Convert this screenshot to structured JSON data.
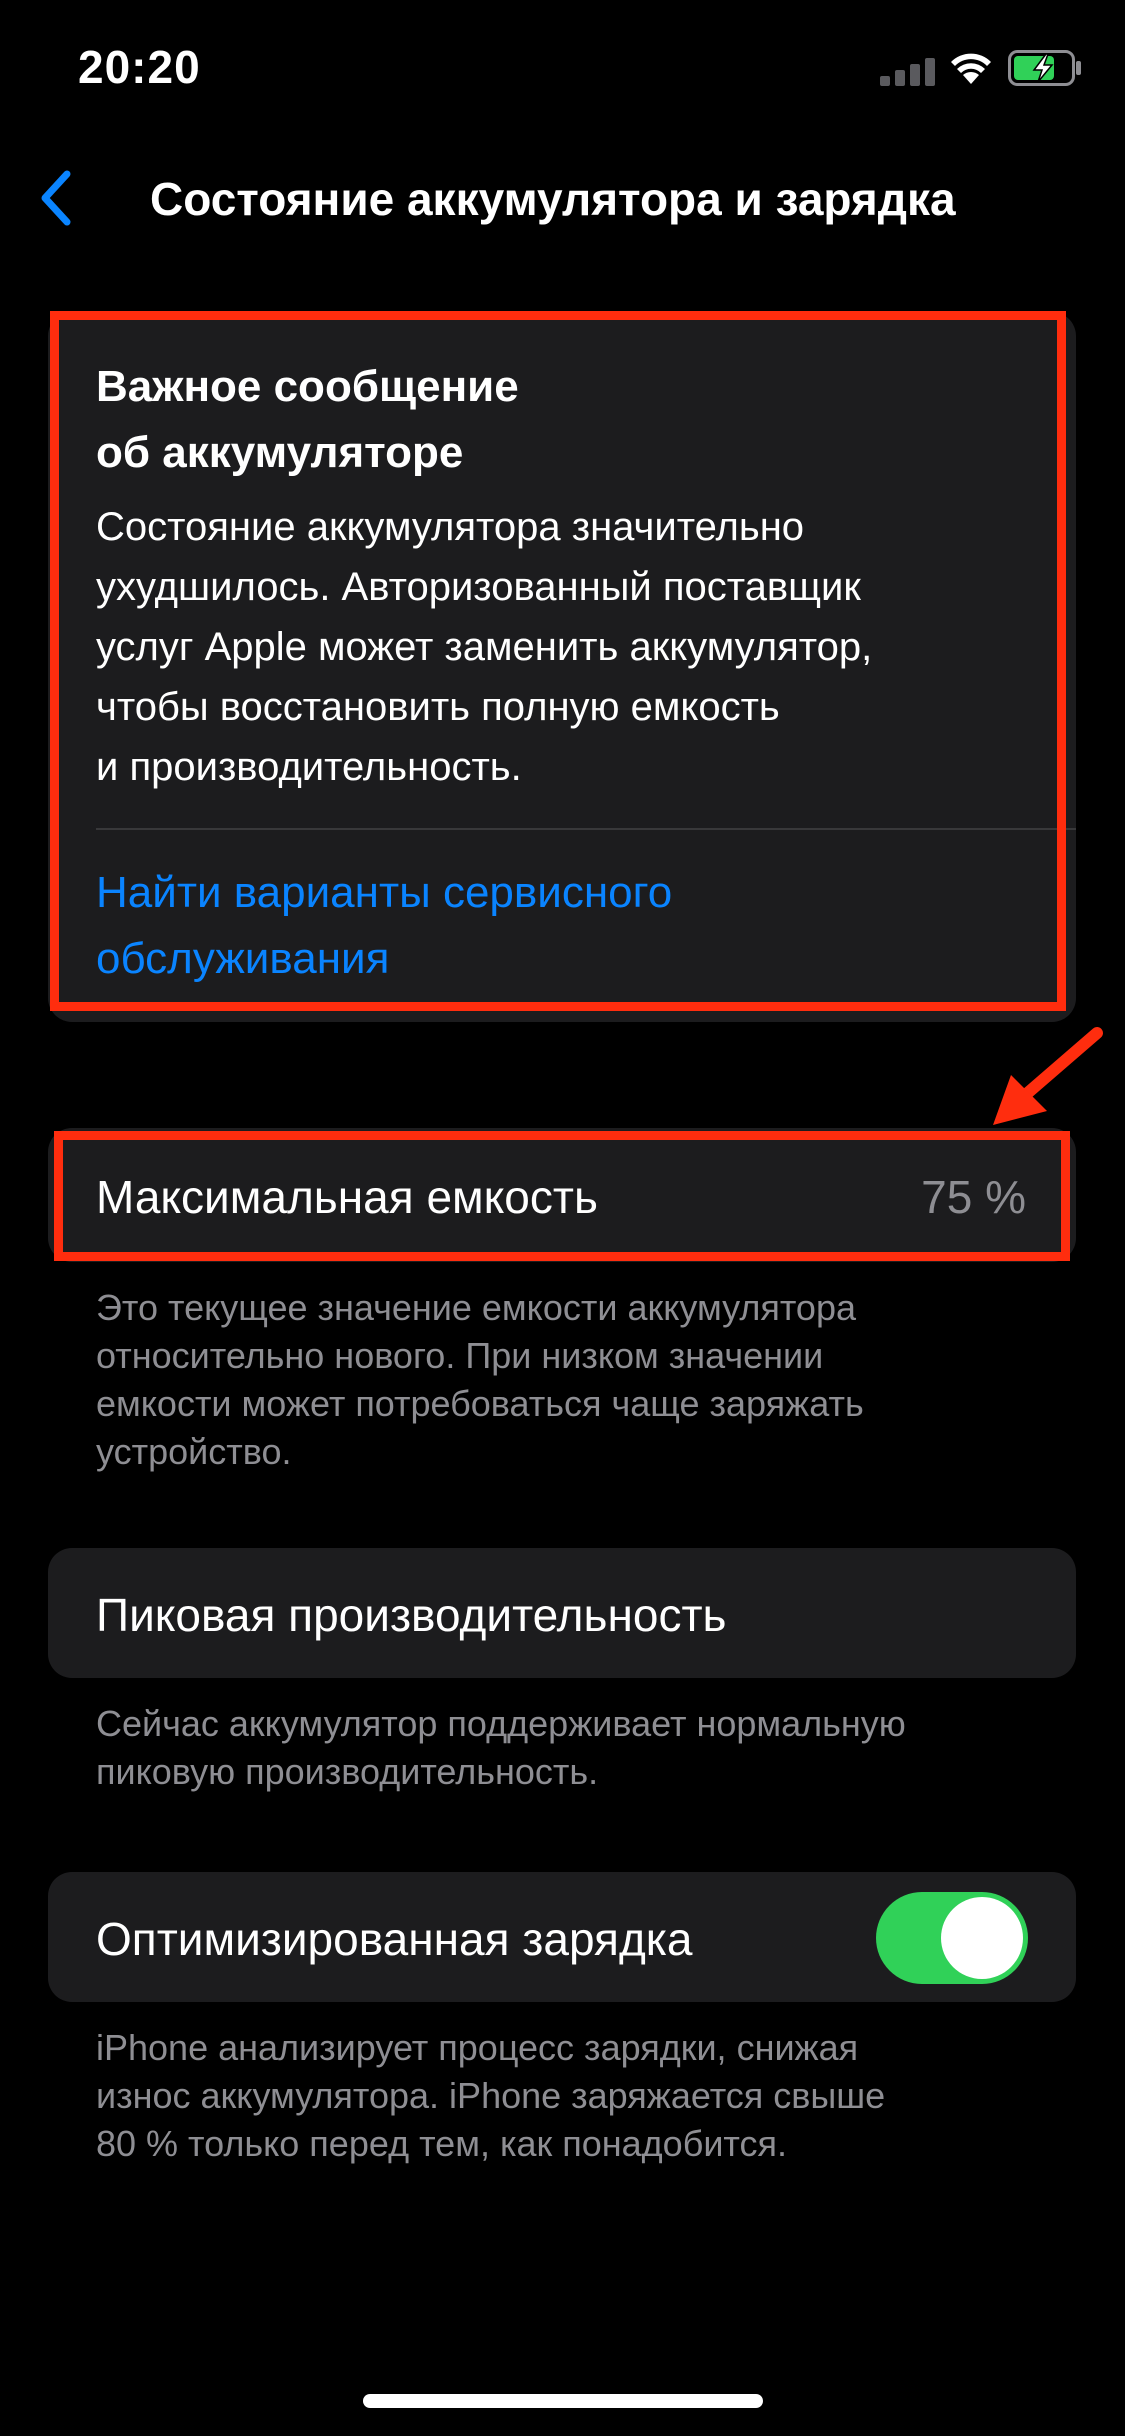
{
  "status_bar": {
    "time": "20:20",
    "icons": [
      "cellular-signal-icon",
      "wifi-icon",
      "battery-charging-icon"
    ]
  },
  "nav": {
    "back_icon": "chevron-left-icon",
    "title": "Состояние аккумулятора и зарядка"
  },
  "message": {
    "title_line1": "Важное сообщение",
    "title_line2": "об аккумуляторе",
    "body_lines": [
      "Состояние аккумулятора значительно",
      "ухудшилось. Авторизованный поставщик",
      "услуг Apple может заменить аккумулятор,",
      "чтобы восстановить полную емкость",
      "и производительность."
    ],
    "link_line1": "Найти варианты сервисного",
    "link_line2": "обслуживания"
  },
  "capacity": {
    "label": "Максимальная емкость",
    "value": "75 %",
    "footnote_lines": [
      "Это текущее значение емкости аккумулятора",
      "относительно нового. При низком значении",
      "емкости может потребоваться чаще заряжать",
      "устройство."
    ]
  },
  "peak": {
    "label": "Пиковая производительность",
    "footnote_lines": [
      "Сейчас аккумулятор поддерживает нормальную",
      "пиковую производительность."
    ]
  },
  "charging": {
    "label": "Оптимизированная зарядка",
    "toggle_on": true,
    "footnote_lines": [
      "iPhone анализирует процесс зарядки, снижая",
      "износ аккумулятора. iPhone заряжается свыше",
      "80 % только перед тем, как понадобится."
    ]
  },
  "colors": {
    "background": "#000000",
    "card": "#1c1c1e",
    "accent_link": "#0a84ff",
    "toggle_on": "#30d158",
    "secondary_text": "#8e8e93",
    "annotation_red": "#ff2d0e"
  }
}
